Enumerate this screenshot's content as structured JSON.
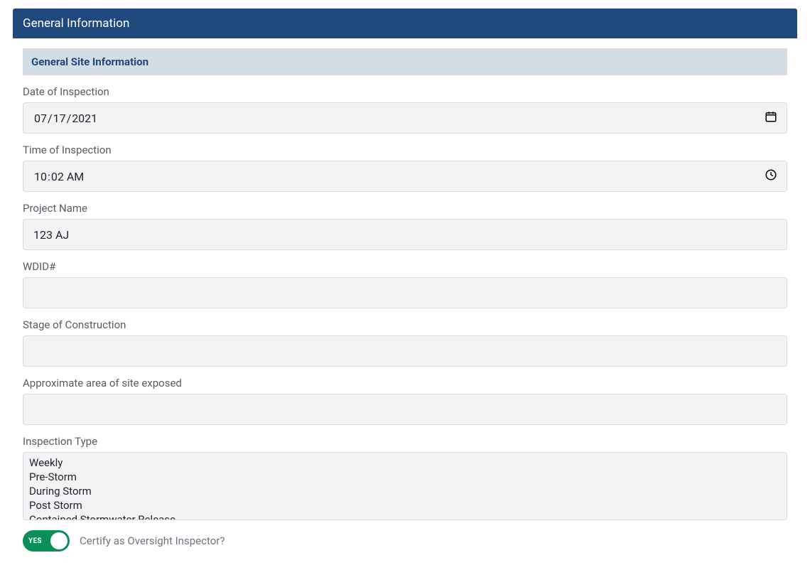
{
  "panel": {
    "title": "General Information",
    "subheader": "General Site Information"
  },
  "fields": {
    "date_of_inspection": {
      "label": "Date of Inspection",
      "value": "2021-07-17",
      "display": "07/17/2021"
    },
    "time_of_inspection": {
      "label": "Time of Inspection",
      "value": "10:02",
      "display": "10:02 AM"
    },
    "project_name": {
      "label": "Project Name",
      "value": "123 AJ"
    },
    "wdid": {
      "label": "WDID#",
      "value": ""
    },
    "stage_of_construction": {
      "label": "Stage of Construction",
      "value": ""
    },
    "approx_area_exposed": {
      "label": "Approximate area of site exposed",
      "value": ""
    },
    "inspection_type": {
      "label": "Inspection Type",
      "options": [
        "Weekly",
        "Pre-Storm",
        "During Storm",
        "Post Storm",
        "Contained Stormwater Release"
      ]
    }
  },
  "toggle": {
    "state_label": "YES",
    "text": "Certify as Oversight Inspector?",
    "value": true
  }
}
